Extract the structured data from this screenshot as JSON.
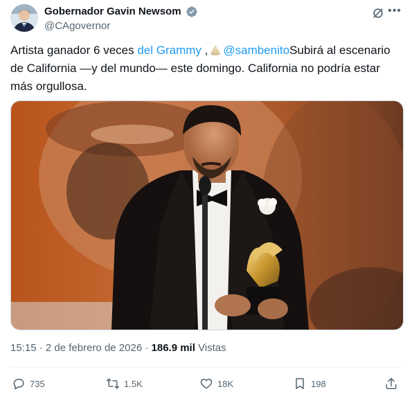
{
  "author": {
    "display_name": "Gobernador Gavin Newsom",
    "handle": "@CAgovernor",
    "verified": true,
    "verified_color": "#829aab"
  },
  "tweet": {
    "text_1": "Artista ganador 6 veces ",
    "link_1": "del Grammy",
    "text_2": " ,",
    "emoji_name": "poop-emoji",
    "mention": "@sambenito",
    "text_3": "Subirá al escenario de California —y del mundo— este domingo. California no podría estar más orgullosa."
  },
  "media": {
    "description_icon": "photo"
  },
  "meta": {
    "time": "15:15",
    "separator": "·",
    "date": "2 de febrero de 2026",
    "views": "186.9 mil",
    "views_label": "Vistas"
  },
  "actions": {
    "replies": "735",
    "reposts": "1.5K",
    "likes": "18K",
    "bookmarks": "198"
  },
  "colors": {
    "link": "#1d9bf0",
    "secondary_text": "#536471",
    "primary_text": "#0f1419"
  }
}
